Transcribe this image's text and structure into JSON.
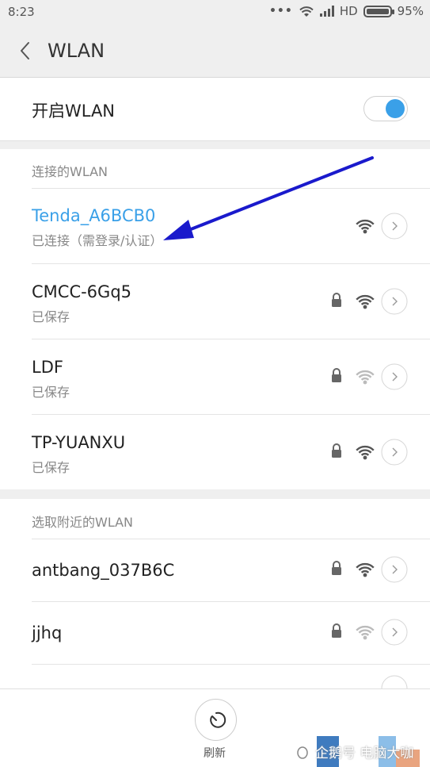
{
  "status_bar": {
    "time": "8:23",
    "dots": "•••",
    "network": "HD",
    "battery": "95%",
    "battery_level": 0.95
  },
  "header": {
    "title": "WLAN"
  },
  "toggle": {
    "label": "开启WLAN",
    "on": true
  },
  "connected_section": {
    "heading": "连接的WLAN",
    "networks": [
      {
        "name": "Tenda_A6BCB0",
        "status": "已连接（需登录/认证）",
        "locked": false
      },
      {
        "name": "CMCC-6Gq5",
        "status": "已保存",
        "locked": true
      },
      {
        "name": "LDF",
        "status": "已保存",
        "locked": true
      },
      {
        "name": "TP-YUANXU",
        "status": "已保存",
        "locked": true
      }
    ]
  },
  "nearby_section": {
    "heading": "选取附近的WLAN",
    "networks": [
      {
        "name": "antbang_037B6C",
        "locked": true
      },
      {
        "name": "jjhq",
        "locked": true
      }
    ]
  },
  "bottom": {
    "refresh_label": "刷新",
    "watermark": "企鹅号 电脑大咖"
  },
  "colors": {
    "accent": "#3aa0e8",
    "annotation_arrow": "#1a1acc"
  }
}
